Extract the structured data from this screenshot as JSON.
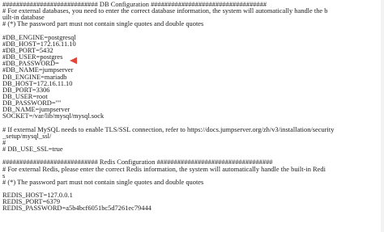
{
  "editor": {
    "lines": [
      "############################ DB Configuration ##################################",
      "# For external databases, you need to enter the correct database information, the system will automatically handle the b",
      "uilt-in database",
      "# (*) The password part must not contain single quotes and double quotes",
      "",
      "#DB_ENGINE=postgresql",
      "#DB_HOST=172.16.11.10",
      "#DB_PORT=5432",
      "#DB_USER=postgres",
      "#DB_PASSWORD=",
      "#DB_NAME=jumpserver",
      "DB_ENGINE=mariadb",
      "DB_HOST=172.16.11.10",
      "DB_PORT=3306",
      "DB_USER=root",
      "DB_PASSWORD=\"\"",
      "DB_NAME=jumpserver",
      "SOCKET=/var/lib/mysql/mysql.sock",
      "",
      "# If external MySQL needs to enable TLS/SSL connection, refer to https://docs.jumpserver.org/zh/v3/installation/security",
      "_setup/mysql_ssl/",
      "#",
      "# DB_USE_SSL=true",
      "",
      "############################ Redis Configuration ##################################",
      "# For external Redis, please enter the correct Redis information, the system will automatically handle the built-in Redi",
      "s",
      "# (*) The password part must not contain single quotes and double quotes",
      "",
      "REDIS_HOST=127.0.0.1",
      "REDIS_PORT=6379",
      "REDIS_PASSWORD=a5b4bcf6051bc5d7261ec79444"
    ]
  },
  "annotation": {
    "arrow_color": "#e0463a"
  }
}
